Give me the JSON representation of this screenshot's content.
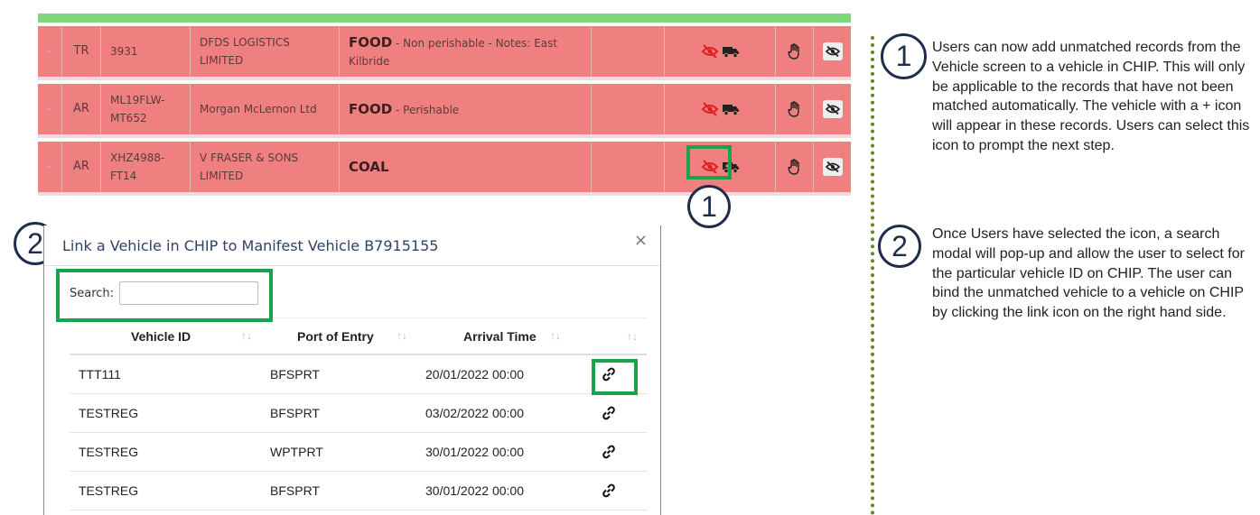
{
  "manifest_rows": [
    {
      "type": "TR",
      "reg": "3931",
      "company": "DFDS LOGISTICS LIMITED",
      "goods_main": "FOOD",
      "goods_sub": " - Non perishable - Notes: East Kilbride"
    },
    {
      "type": "AR",
      "reg": "ML19FLW-MT652",
      "company": "Morgan McLernon Ltd",
      "goods_main": "FOOD",
      "goods_sub": " - Perishable"
    },
    {
      "type": "AR",
      "reg": "XHZ4988-FT14",
      "company": "V FRASER & SONS LIMITED",
      "goods_main": "COAL",
      "goods_sub": ""
    }
  ],
  "icons": {
    "expand": "triangle-right-icon",
    "hidden": "eye-slash-icon",
    "truck": "truck-icon",
    "hand": "hand-icon",
    "hide_toggle": "eye-slash-icon",
    "link": "link-icon",
    "close": "close-icon"
  },
  "callouts": {
    "one": "1",
    "two": "2"
  },
  "modal": {
    "title": "Link a Vehicle in CHIP to Manifest Vehicle B7915155",
    "close": "×",
    "search_label": "Search:",
    "search_value": "",
    "columns": [
      "Vehicle ID",
      "Port of Entry",
      "Arrival Time"
    ],
    "rows": [
      {
        "vehicle_id": "TTT111",
        "port": "BFSPRT",
        "arrival": "20/01/2022 00:00"
      },
      {
        "vehicle_id": "TESTREG",
        "port": "BFSPRT",
        "arrival": "03/02/2022 00:00"
      },
      {
        "vehicle_id": "TESTREG",
        "port": "WPTPRT",
        "arrival": "30/01/2022 00:00"
      },
      {
        "vehicle_id": "TESTREG",
        "port": "BFSPRT",
        "arrival": "30/01/2022 00:00"
      }
    ]
  },
  "notes": {
    "one": "Users can now add unmatched records from the Vehicle screen to a vehicle in CHIP. This will only be applicable to the records that have not been matched automatically. The vehicle with a + icon will appear in these records. Users can select this icon to prompt the next step.",
    "two": "Once Users have selected the icon, a search modal will pop-up and allow the user to select for the particular vehicle ID on CHIP. The user can bind the unmatched vehicle to a vehicle on CHIP by clicking the link icon on the right hand side."
  },
  "colors": {
    "row_bg": "#f08080",
    "header_bar": "#7ed67e",
    "highlight": "#1aa34a",
    "icon_red": "#e02020",
    "callout": "#1f2d4d"
  }
}
